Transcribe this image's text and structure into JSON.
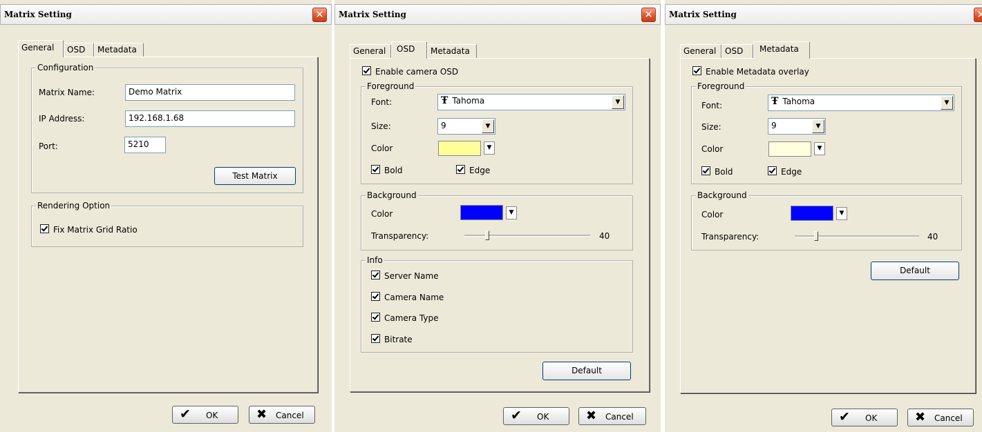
{
  "dialogs": {
    "general": {
      "title": "Matrix Setting",
      "tabs": [
        "General",
        "OSD",
        "Metadata"
      ],
      "active_tab": "General",
      "configuration": {
        "group_label": "Configuration",
        "matrix_name_label": "Matrix Name:",
        "matrix_name_value": "Demo Matrix",
        "ip_label": "IP Address:",
        "ip_value": "192.168.1.68",
        "port_label": "Port:",
        "port_value": "5210",
        "test_button": "Test Matrix"
      },
      "rendering": {
        "group_label": "Rendering Option",
        "fix_ratio_label": "Fix Matrix Grid Ratio",
        "fix_ratio_checked": true
      },
      "ok_label": "OK",
      "cancel_label": "Cancel"
    },
    "osd": {
      "title": "Matrix Setting",
      "tabs": [
        "General",
        "OSD",
        "Metadata"
      ],
      "active_tab": "OSD",
      "enable_label": "Enable camera OSD",
      "enable_checked": true,
      "foreground": {
        "group_label": "Foreground",
        "font_label": "Font:",
        "font_value": "Tahoma",
        "size_label": "Size:",
        "size_value": "9",
        "color_label": "Color",
        "color_value": "#FFFF99",
        "bold_label": "Bold",
        "edge_label": "Edge"
      },
      "background": {
        "group_label": "Background",
        "color_label": "Color",
        "color_value": "#0000FF",
        "transparency_label": "Transparency:",
        "transparency_value": "40"
      },
      "info": {
        "group_label": "Info",
        "items": [
          "Server Name",
          "Camera Name",
          "Camera Type",
          "Bitrate"
        ]
      },
      "default_button": "Default",
      "ok_label": "OK",
      "cancel_label": "Cancel"
    },
    "metadata": {
      "title": "Matrix Setting",
      "tabs": [
        "General",
        "OSD",
        "Metadata"
      ],
      "active_tab": "Metadata",
      "enable_label": "Enable Metadata overlay",
      "enable_checked": true,
      "foreground": {
        "group_label": "Foreground",
        "font_label": "Font:",
        "font_value": "Tahoma",
        "size_label": "Size:",
        "size_value": "9",
        "color_label": "Color",
        "color_value": "#FFFFE0",
        "bold_label": "Bold",
        "edge_label": "Edge"
      },
      "background": {
        "group_label": "Background",
        "color_label": "Color",
        "color_value": "#0000FF",
        "transparency_label": "Transparency:",
        "transparency_value": "40"
      },
      "default_button": "Default",
      "ok_label": "OK",
      "cancel_label": "Cancel"
    }
  }
}
